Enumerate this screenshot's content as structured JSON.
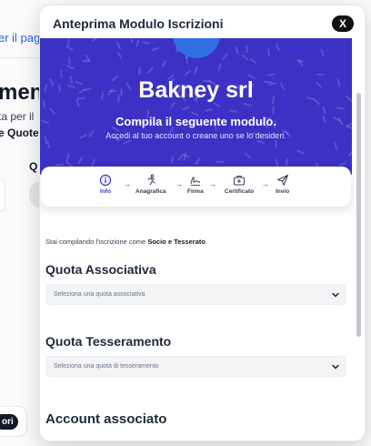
{
  "background": {
    "link_text": "er il pag",
    "heading": "ment",
    "text_line1": "ta per il",
    "text_line2": "e Quote",
    "q_label": "Q",
    "chip_label": "ori"
  },
  "modal": {
    "title": "Anteprima Modulo Iscrizioni",
    "close_label": "X"
  },
  "hero": {
    "company": "Bakney srl",
    "subtitle": "Compila il seguente modulo.",
    "note": "Accedi al tuo account o creane uno se lo desideri.",
    "bg_color": "#3b31c4",
    "circle_color": "#2f6fe2"
  },
  "steps": [
    {
      "label": "Info",
      "icon": "info-icon",
      "active": true
    },
    {
      "label": "Anagrafica",
      "icon": "person-running-icon",
      "active": false
    },
    {
      "label": "Firma",
      "icon": "signature-icon",
      "active": false
    },
    {
      "label": "Certificato",
      "icon": "medical-case-icon",
      "active": false
    },
    {
      "label": "Invio",
      "icon": "send-icon",
      "active": false
    }
  ],
  "form": {
    "compiling_prefix": "Stai compilando l'iscrizione come ",
    "compiling_role": "Socio e Tesserato",
    "compiling_suffix": ".",
    "quota_associativa_title": "Quota Associativa",
    "quota_associativa_placeholder": "Seleziona una quota associativa",
    "quota_tesseramento_title": "Quota Tesseramento",
    "quota_tesseramento_placeholder": "Seleziona una quota di tesseramento",
    "account_title": "Account associato"
  },
  "colors": {
    "accent": "#4338ca",
    "close_button": "#111111"
  }
}
